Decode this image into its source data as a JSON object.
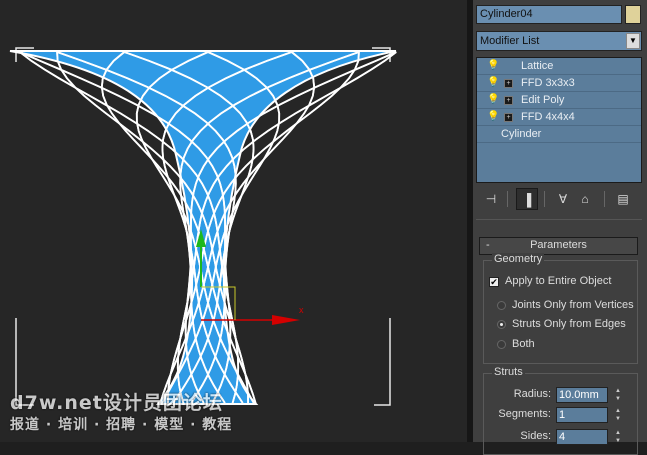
{
  "viewport": {
    "watermark_line1": "d7w.net设计员团论坛",
    "watermark_line2": "报道 · 培训 · 招聘 · 模型 · 教程",
    "gizmo_x_label": "x"
  },
  "panel": {
    "object_name": "Cylinder04",
    "object_color": "#dfd29a",
    "modifier_list_label": "Modifier List",
    "stack": [
      {
        "label": "Lattice",
        "has_bulb": true,
        "has_expand": false
      },
      {
        "label": "FFD 3x3x3",
        "has_bulb": true,
        "has_expand": true
      },
      {
        "label": "Edit Poly",
        "has_bulb": true,
        "has_expand": true
      },
      {
        "label": "FFD 4x4x4",
        "has_bulb": true,
        "has_expand": true
      },
      {
        "label": "Cylinder",
        "has_bulb": false,
        "has_expand": false
      }
    ],
    "toolbar_icons": [
      "pin-stack-icon",
      "show-end-result-icon",
      "make-unique-icon",
      "remove-modifier-icon",
      "configure-sets-icon"
    ]
  },
  "parameters": {
    "rollout_title": "Parameters",
    "rollout_toggle": "-",
    "geometry_title": "Geometry",
    "apply_entire_label": "Apply to Entire Object",
    "apply_entire_checked": true,
    "options": [
      {
        "label": "Joints Only from Vertices",
        "selected": false
      },
      {
        "label": "Struts Only from Edges",
        "selected": true
      },
      {
        "label": "Both",
        "selected": false
      }
    ],
    "struts_title": "Struts",
    "radius_label": "Radius:",
    "radius_value": "10.0mm",
    "segments_label": "Segments:",
    "segments_value": "1",
    "sides_label": "Sides:",
    "sides_value": "4"
  },
  "colors": {
    "mesh_fill": "#2f9be6",
    "wire": "#ffffff",
    "gizmo_x": "#d40000",
    "gizmo_y": "#1db81d",
    "stack_bg": "#5b7d9b"
  }
}
